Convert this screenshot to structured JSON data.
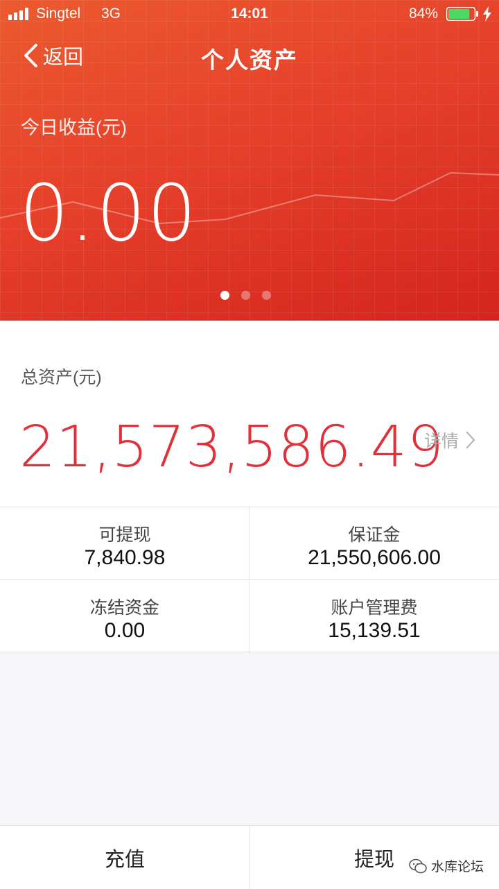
{
  "status_bar": {
    "carrier": "Singtel",
    "network": "3G",
    "time": "14:01",
    "battery_percent": "84%",
    "battery_level": 0.84
  },
  "nav": {
    "back_label": "返回",
    "title": "个人资产"
  },
  "today_earnings": {
    "label": "今日收益(元)",
    "value": "0.00",
    "page_count": 3,
    "active_page": 1
  },
  "total_assets": {
    "label": "总资产(元)",
    "value": "21,573,586.49",
    "detail_label": "详情"
  },
  "stats": [
    {
      "label": "可提现",
      "value": "7,840.98"
    },
    {
      "label": "保证金",
      "value": "21,550,606.00"
    },
    {
      "label": "冻结资金",
      "value": "0.00"
    },
    {
      "label": "账户管理费",
      "value": "15,139.51"
    }
  ],
  "actions": {
    "deposit_label": "充值",
    "withdraw_label": "提现"
  },
  "watermark": {
    "text": "水库论坛"
  },
  "colors": {
    "accent_red": "#e0303a",
    "header_gradient_start": "#ec5a2e",
    "header_gradient_end": "#d4241e"
  }
}
